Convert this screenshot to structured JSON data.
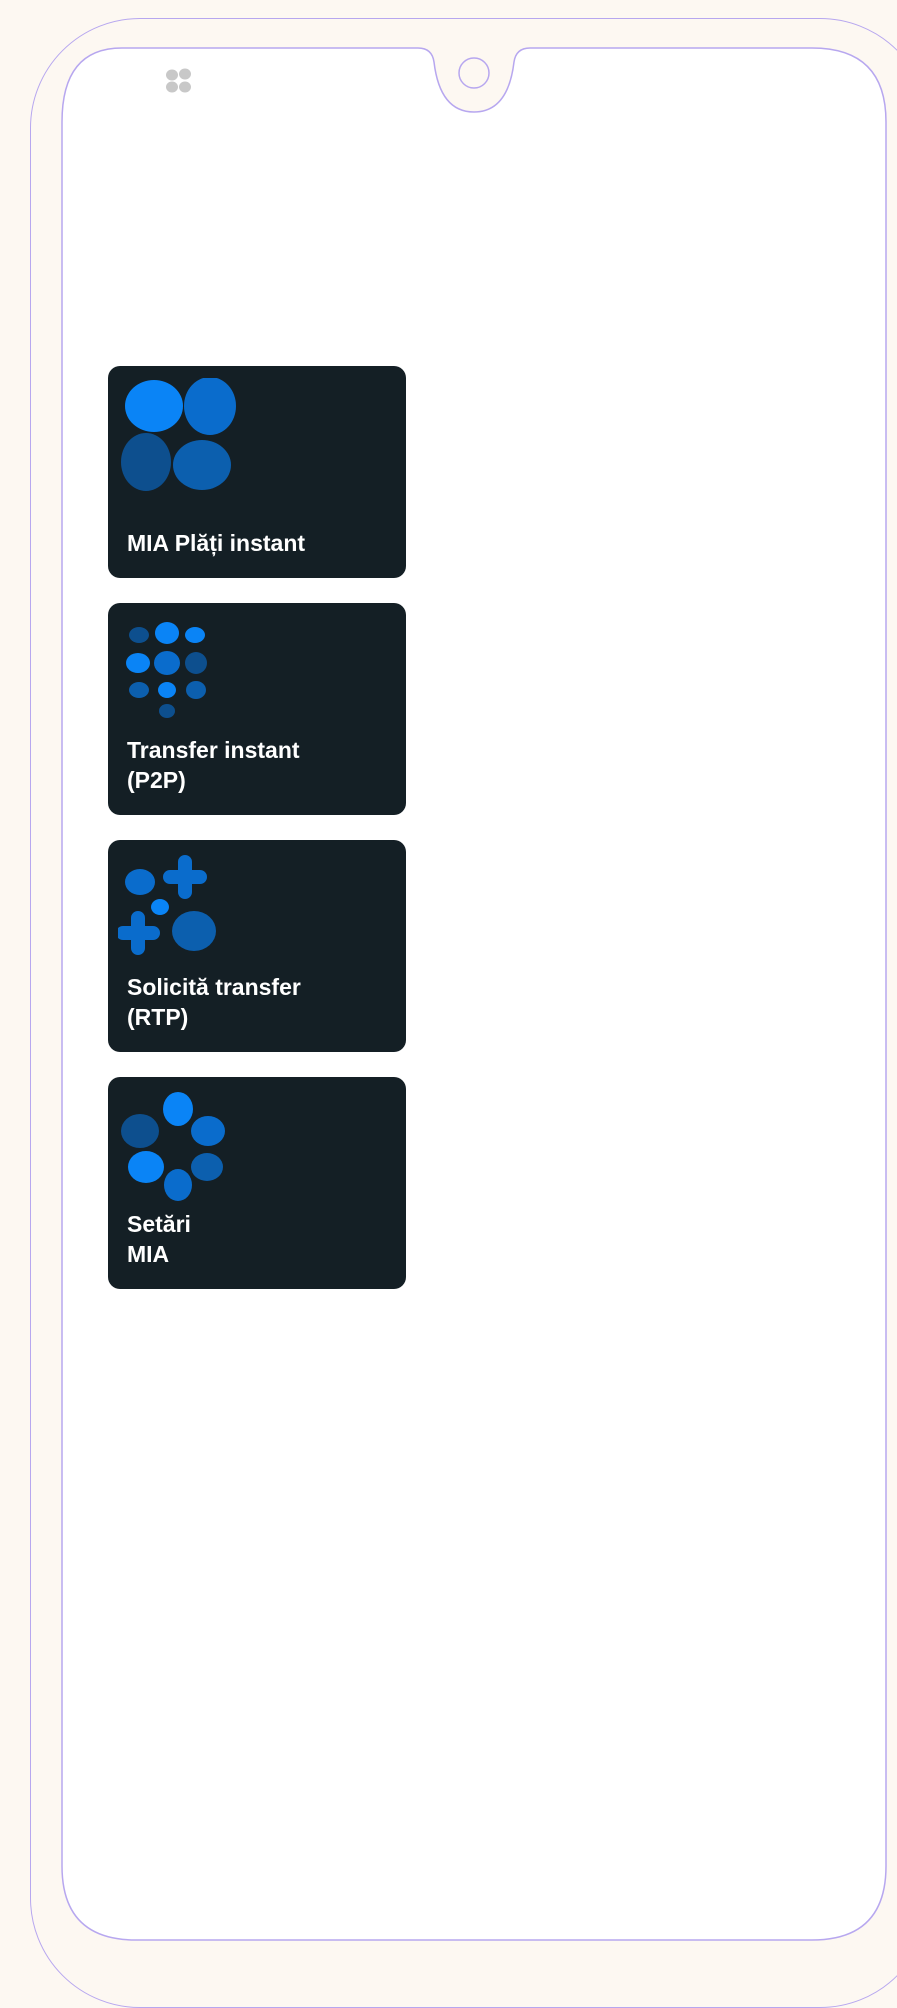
{
  "tiles": [
    {
      "label": "MIA Plăți instant",
      "icon": "mia-logo-icon"
    },
    {
      "label": "Transfer instant\n(P2P)",
      "icon": "dots-grid-icon"
    },
    {
      "label": "Solicită transfer\n(RTP)",
      "icon": "request-transfer-icon"
    },
    {
      "label": "Setări\nMIA",
      "icon": "settings-flower-icon"
    }
  ],
  "colors": {
    "tile_bg": "#141f25",
    "accent_bright": "#0a84f6",
    "accent_mid": "#0a6ccc",
    "accent_dark": "#0d4f8e",
    "frame_outline": "#b7a7ef"
  }
}
